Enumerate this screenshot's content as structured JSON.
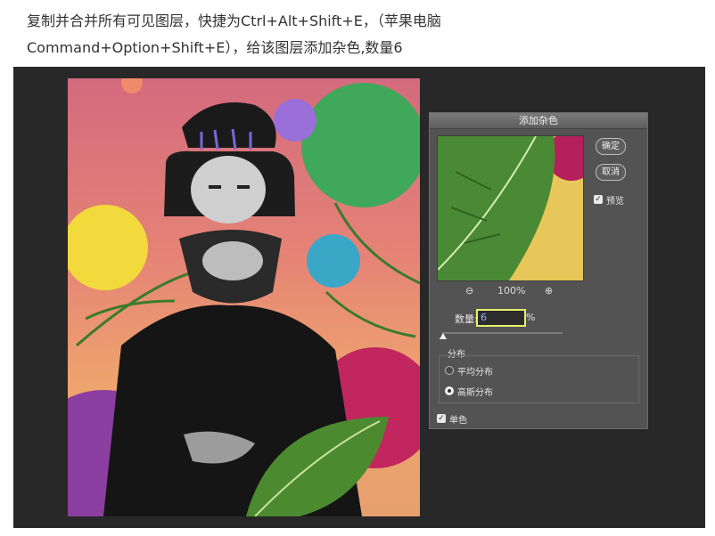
{
  "caption": {
    "line1": "复制并合并所有可见图层，快捷为Ctrl+Alt+Shift+E，（苹果电脑",
    "line2": "Command+Option+Shift+E），给该图层添加杂色,数量6"
  },
  "dialog": {
    "title": "添加杂色",
    "ok_label": "确定",
    "cancel_label": "取消",
    "preview_label": "预览",
    "zoom_level": "100%",
    "zoom_out_icon": "zoom-out-icon",
    "zoom_in_icon": "zoom-in-icon",
    "amount_label": "数量:",
    "amount_value": "6",
    "amount_unit": "%",
    "distribution_label": "分布",
    "uniform_label": "平均分布",
    "gaussian_label": "高斯分布",
    "monochrome_label": "单色"
  },
  "colors": {
    "workspace": "#282828",
    "dialog_bg": "#535353",
    "highlight": "#e6f06e"
  }
}
